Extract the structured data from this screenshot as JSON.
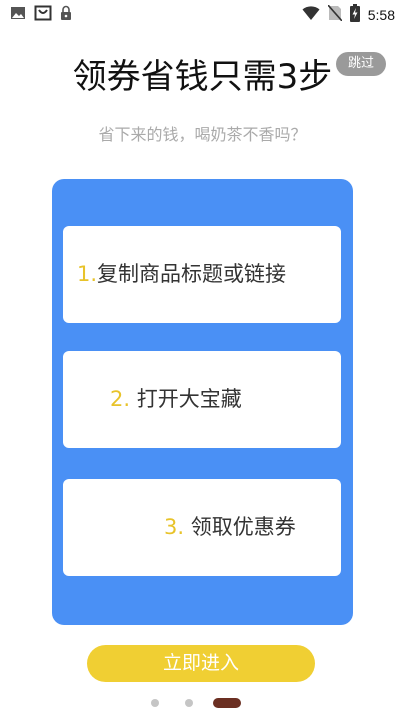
{
  "status_bar": {
    "time": "5:58",
    "left_icons": [
      "image-icon",
      "shopping-bag-icon",
      "lock-icon"
    ],
    "right_icons": [
      "wifi-icon",
      "no-sim-icon",
      "battery-charging-icon"
    ]
  },
  "header": {
    "skip_label": "跳过",
    "title": "领券省钱只需3步",
    "subtitle": "省下来的钱，喝奶茶不香吗？"
  },
  "steps": [
    {
      "number": "1.",
      "label": "复制商品标题或链接"
    },
    {
      "number": "2.",
      "label": "打开大宝藏"
    },
    {
      "number": "3.",
      "label": "领取优惠券"
    }
  ],
  "footer": {
    "enter_label": "立即进入",
    "pager": {
      "count": 3,
      "active_index": 2
    }
  },
  "colors": {
    "panel": "#4a90f5",
    "step_number": "#e8c32a",
    "enter_button": "#f0cf33",
    "active_dot": "#6b2f22",
    "inactive_dot": "#c5c5c5",
    "skip_button": "#9a9a9a"
  }
}
